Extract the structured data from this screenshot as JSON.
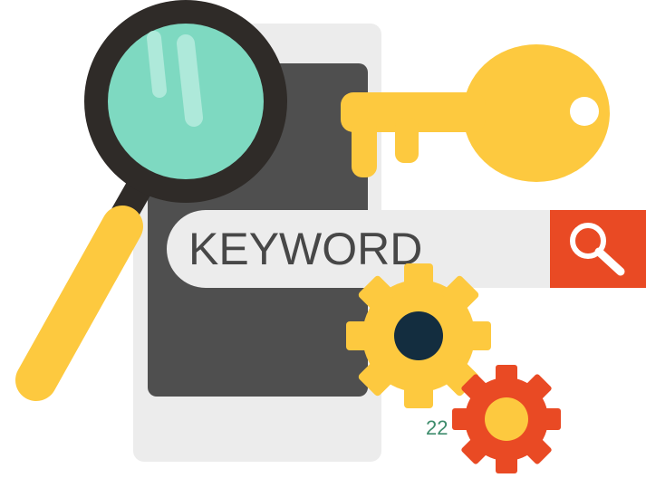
{
  "search": {
    "keyword": "KEYWORD"
  },
  "page": {
    "number": "22"
  },
  "icons": {
    "magnifier": "magnifier-icon",
    "key": "key-icon",
    "search_button": "search-icon",
    "gear_large": "gear-icon",
    "gear_small": "gear-icon"
  },
  "colors": {
    "search_button": "#e94a24",
    "key": "#fdc93f",
    "lens": "#7ed9c1",
    "magnifier_rim": "#2f2b28",
    "phone_frame": "#ececec",
    "phone_screen": "#4f4f4f",
    "gear_yellow": "#fdc93f",
    "gear_red": "#e94a24",
    "gear_center_dark": "#132d3f",
    "page_number": "#3e8c6c"
  }
}
